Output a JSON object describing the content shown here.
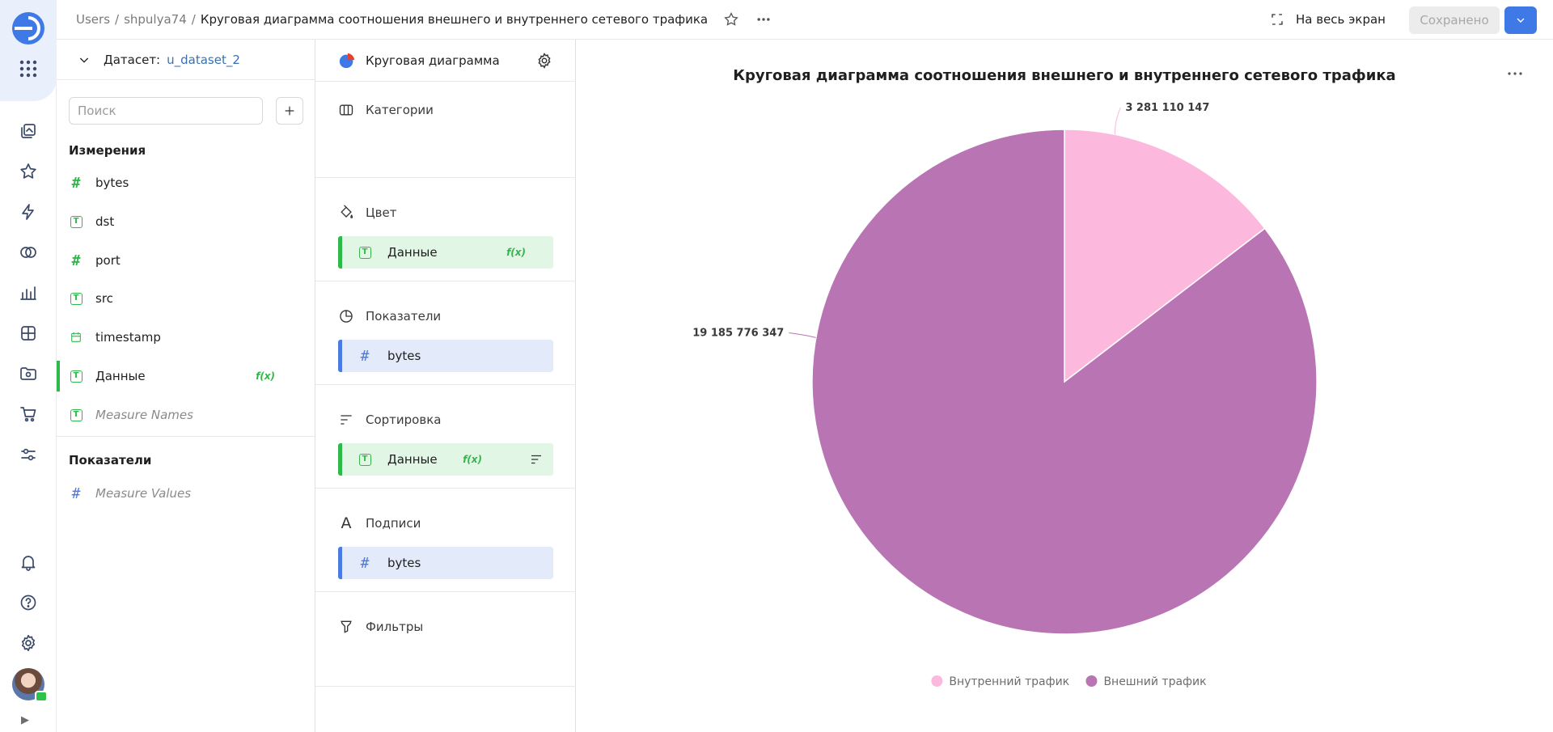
{
  "header": {
    "breadcrumb": [
      "Users",
      "shpulya74"
    ],
    "title": "Круговая диаграмма соотношения внешнего и внутреннего сетевого трафика",
    "fullscreen_label": "На весь экран",
    "saved_label": "Сохранено"
  },
  "dataset": {
    "label": "Датасет:",
    "name": "u_dataset_2",
    "search_placeholder": "Поиск",
    "dimensions_title": "Измерения",
    "dimensions": [
      {
        "label": "bytes",
        "type": "number"
      },
      {
        "label": "dst",
        "type": "text"
      },
      {
        "label": "port",
        "type": "number"
      },
      {
        "label": "src",
        "type": "text"
      },
      {
        "label": "timestamp",
        "type": "date"
      },
      {
        "label": "Данные",
        "type": "text",
        "formula": true,
        "active": true
      },
      {
        "label": "Measure Names",
        "type": "text",
        "italic": true
      }
    ],
    "measures_title": "Показатели",
    "measures": [
      {
        "label": "Measure Values",
        "type": "number",
        "italic": true
      }
    ]
  },
  "visualization": {
    "type_label": "Круговая диаграмма",
    "sections": {
      "categories": {
        "title": "Категории"
      },
      "color": {
        "title": "Цвет",
        "item": "Данные"
      },
      "measures": {
        "title": "Показатели",
        "item": "bytes"
      },
      "sort": {
        "title": "Сортировка",
        "item": "Данные"
      },
      "labels": {
        "title": "Подписи",
        "item": "bytes"
      },
      "filters": {
        "title": "Фильтры"
      }
    },
    "formula_badge": "f(x)"
  },
  "colors": {
    "accent": "#3e79e6",
    "dimension_green": "#2fb94a",
    "measure_blue": "#4a7ce0",
    "slice_internal": "#fdb8de",
    "slice_external": "#b974b3"
  },
  "chart_data": {
    "type": "pie",
    "title": "Круговая диаграмма соотношения внешнего и внутреннего сетевого трафика",
    "slices": [
      {
        "name": "Внутренний трафик",
        "value": 3281110147,
        "label": "3 281 110 147",
        "color": "#fdb8de"
      },
      {
        "name": "Внешний трафик",
        "value": 19185776347,
        "label": "19 185 776 347",
        "color": "#b974b3"
      }
    ],
    "legend_position": "bottom"
  }
}
